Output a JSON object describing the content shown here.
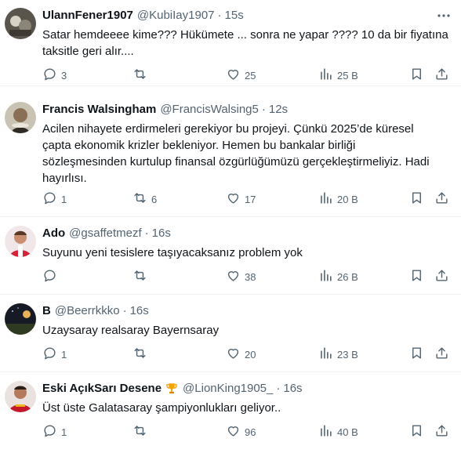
{
  "tweets": [
    {
      "name": "UlannFener1907",
      "badge": "",
      "handle": "@KubiIay1907",
      "sep": "·",
      "time": "15s",
      "text": "Satar hemdeeee kime??? Hükümete ... sonra ne yapar ???? 10 da bir fiyatına\ntaksitle geri alır....",
      "replies": "3",
      "retweets": "",
      "likes": "25",
      "views": "25 B"
    },
    {
      "name": "Francis Walsingham",
      "badge": "",
      "handle": "@FrancisWalsing5",
      "sep": "·",
      "time": "12s",
      "text": "Acilen nihayete erdirmeleri gerekiyor bu projeyi. Çünkü 2025’de küresel\nçapta ekonomik krizler bekleniyor. Hemen bu bankalar birliği\nsözleşmesinden kurtulup finansal özgürlüğümüzü gerçekleştirmeliyiz. Hadi\nhayırlısı.",
      "replies": "1",
      "retweets": "6",
      "likes": "17",
      "views": "20 B"
    },
    {
      "name": "Ado",
      "badge": "",
      "handle": "@gsaffetmezf",
      "sep": "·",
      "time": "16s",
      "text": "Suyunu yeni tesislere taşıyacaksanız problem yok",
      "replies": "",
      "retweets": "",
      "likes": "38",
      "views": "26 B"
    },
    {
      "name": "B",
      "badge": "",
      "handle": "@Beerrkkko",
      "sep": "·",
      "time": "16s",
      "text": "Uzaysaray realsaray Bayernsaray",
      "replies": "1",
      "retweets": "",
      "likes": "20",
      "views": "23 B"
    },
    {
      "name": "Eski AçıkSarı Desene",
      "badge": "trophy-icon",
      "handle": "@LionKing1905_",
      "sep": "·",
      "time": "16s",
      "text": "Üst üste Galatasaray şampiyonlukları geliyor..",
      "replies": "1",
      "retweets": "",
      "likes": "96",
      "views": "40 B"
    }
  ],
  "icons": {
    "reply": "reply-icon",
    "retweet": "retweet-icon",
    "like": "heart-icon",
    "views": "views-chart-icon",
    "bookmark": "bookmark-icon",
    "share": "share-icon",
    "more": "more-dots-icon"
  },
  "colors": {
    "text": "#0f1419",
    "muted": "#536471",
    "divider": "#eff3f4",
    "trophy": "#f4a300"
  }
}
